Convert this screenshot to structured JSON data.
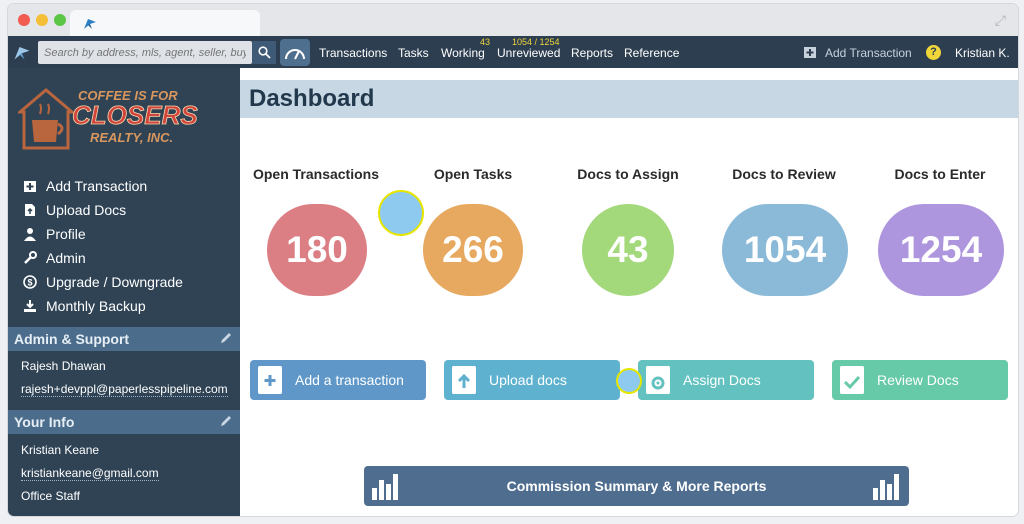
{
  "browser": {
    "dots": [
      "#f25b50",
      "#f5be37",
      "#5bc645"
    ]
  },
  "topnav": {
    "search_placeholder": "Search by address, mls, agent, seller, buyer",
    "items": [
      "Transactions",
      "Tasks",
      "Working",
      "Unreviewed",
      "Reports",
      "Reference"
    ],
    "working_count": "43",
    "unreviewed_count": "1054 / 1254",
    "add_transaction": "Add Transaction",
    "help": "?",
    "user": "Kristian K."
  },
  "brand": {
    "line1": "COFFEE IS FOR",
    "line2": "CLOSERS",
    "line3": "REALTY, INC."
  },
  "sidebar": {
    "items": [
      "Add Transaction",
      "Upload Docs",
      "Profile",
      "Admin",
      "Upgrade / Downgrade",
      "Monthly Backup"
    ],
    "admin_header": "Admin & Support",
    "admin_name": "Rajesh Dhawan",
    "admin_email": "rajesh+devppl@paperlesspipeline.com",
    "info_header": "Your Info",
    "info_name": "Kristian Keane",
    "info_email": "kristiankeane@gmail.com",
    "info_role": "Office Staff"
  },
  "dashboard": {
    "title": "Dashboard",
    "stats": [
      {
        "label": "Open Transactions",
        "value": "180",
        "color": "#dc7f84"
      },
      {
        "label": "Open Tasks",
        "value": "266",
        "color": "#e7a85f"
      },
      {
        "label": "Docs to Assign",
        "value": "43",
        "color": "#a3d87b"
      },
      {
        "label": "Docs to Review",
        "value": "1054",
        "color": "#8bbad8"
      },
      {
        "label": "Docs to Enter",
        "value": "1254",
        "color": "#ae96de"
      }
    ],
    "actions": [
      {
        "label": "Add a transaction",
        "color": "#5e97c8"
      },
      {
        "label": "Upload docs",
        "color": "#5fb2cf"
      },
      {
        "label": "Assign Docs",
        "color": "#63c2c0"
      },
      {
        "label": "Review Docs",
        "color": "#66c9a8"
      }
    ],
    "report_button": "Commission Summary & More Reports"
  }
}
